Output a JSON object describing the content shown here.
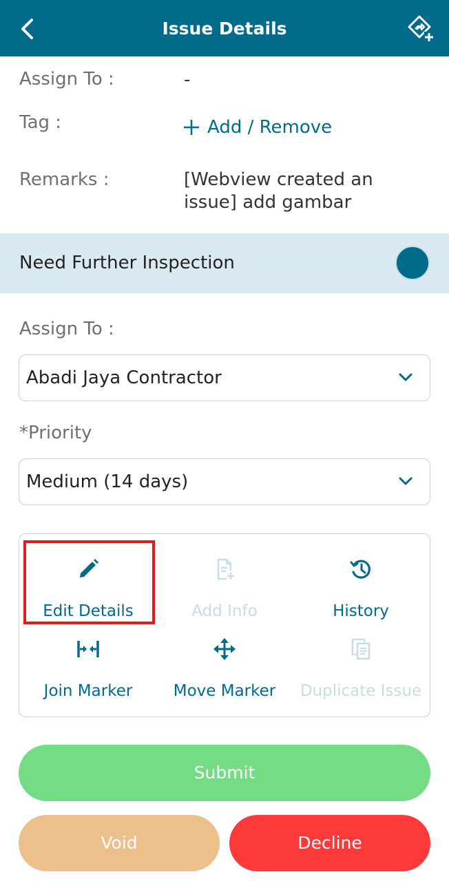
{
  "header": {
    "title": "Issue Details",
    "back_icon": "chevron-left-icon",
    "action_icon": "diamond-plus-icon",
    "background": "#006a8a"
  },
  "details": {
    "assign_to_label": "Assign To :",
    "assign_to_value": "-",
    "tag_label": "Tag :",
    "tag_action": "Add / Remove",
    "remarks_label": "Remarks :",
    "remarks_value_line1": "[Webview created an",
    "remarks_value_line2": "issue] add gambar"
  },
  "inspection": {
    "label": "Need Further Inspection",
    "toggle_on": true
  },
  "form": {
    "assign_to_label": "Assign To :",
    "assign_to_selected": "Abadi Jaya Contractor",
    "priority_label": "*Priority",
    "priority_selected": "Medium (14 days)"
  },
  "actions": [
    {
      "label": "Edit Details",
      "icon": "pencil-icon",
      "enabled": true,
      "highlighted": true
    },
    {
      "label": "Add Info",
      "icon": "document-plus-icon",
      "enabled": false
    },
    {
      "label": "History",
      "icon": "history-icon",
      "enabled": true
    },
    {
      "label": "Join Marker",
      "icon": "join-arrows-icon",
      "enabled": true
    },
    {
      "label": "Move Marker",
      "icon": "move-arrows-icon",
      "enabled": true
    },
    {
      "label": "Duplicate Issue",
      "icon": "copy-document-icon",
      "enabled": false
    }
  ],
  "buttons": {
    "submit": "Submit",
    "void": "Void",
    "decline": "Decline"
  },
  "colors": {
    "accent": "#006a8a",
    "submit": "#74dc84",
    "void": "#ecc08a",
    "decline": "#fc3a3a",
    "highlight": "#e01b1b"
  }
}
